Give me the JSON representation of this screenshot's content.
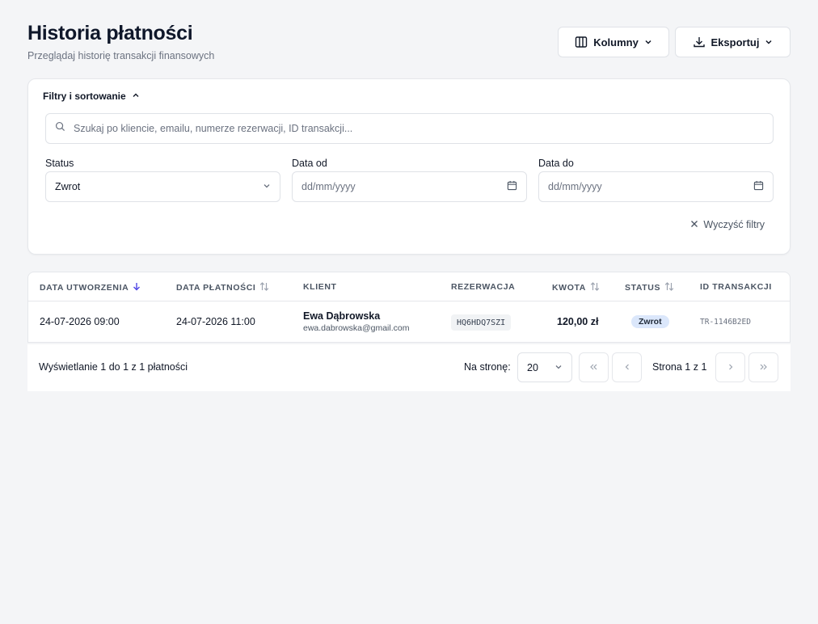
{
  "header": {
    "title": "Historia płatności",
    "subtitle": "Przeglądaj historię transakcji finansowych",
    "columns_label": "Kolumny",
    "export_label": "Eksportuj"
  },
  "filters": {
    "toggle_label": "Filtry i sortowanie",
    "search_placeholder": "Szukaj po kliencie, emailu, numerze rezerwacji, ID transakcji...",
    "status_label": "Status",
    "status_value": "Zwrot",
    "date_from_label": "Data od",
    "date_from_placeholder": "dd/mm/yyyy",
    "date_to_label": "Data do",
    "date_to_placeholder": "dd/mm/yyyy",
    "clear_label": "Wyczyść filtry"
  },
  "table": {
    "columns": {
      "created": "DATA UTWORZENIA",
      "paid": "DATA PŁATNOŚCI",
      "client": "KLIENT",
      "reservation": "REZERWACJA",
      "amount": "KWOTA",
      "status": "STATUS",
      "transaction": "ID TRANSAKCJI"
    },
    "rows": [
      {
        "created": "24-07-2026 09:00",
        "paid": "24-07-2026 11:00",
        "client_name": "Ewa Dąbrowska",
        "client_email": "ewa.dabrowska@gmail.com",
        "reservation": "HQ6HDQ7SZI",
        "amount": "120,00 zł",
        "status": "Zwrot",
        "transaction": "TR-1146B2ED"
      }
    ]
  },
  "pagination": {
    "summary": "Wyświetlanie 1 do 1 z 1 płatności",
    "per_page_label": "Na stronę:",
    "per_page_value": "20",
    "page_info": "Strona 1 z 1"
  },
  "colors": {
    "background": "#f4f5f7",
    "sort_active": "#4f46e5",
    "status_badge": "#dbe7fb"
  }
}
